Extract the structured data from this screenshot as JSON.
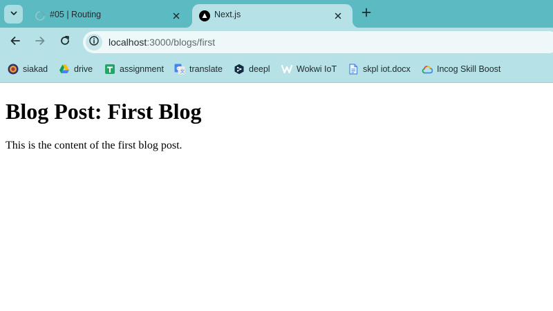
{
  "browser": {
    "tabs": [
      {
        "title": "#05 | Routing",
        "active": false,
        "favicon": "globe-loading-icon"
      },
      {
        "title": "Next.js",
        "active": true,
        "favicon": "nextjs-triangle-icon"
      }
    ],
    "address": {
      "host": "localhost",
      "rest": ":3000/blogs/first"
    },
    "bookmarks": [
      {
        "label": "siakad",
        "icon": "siakad-crest-icon"
      },
      {
        "label": "drive",
        "icon": "google-drive-icon"
      },
      {
        "label": "assignment",
        "icon": "google-sheets-icon"
      },
      {
        "label": "translate",
        "icon": "google-translate-icon"
      },
      {
        "label": "deepl",
        "icon": "deepl-icon"
      },
      {
        "label": "Wokwi IoT",
        "icon": "wokwi-icon"
      },
      {
        "label": "skpl iot.docx",
        "icon": "document-icon"
      },
      {
        "label": "Incog Skill Boost",
        "icon": "google-cloud-icon"
      }
    ],
    "colors": {
      "tab_strip": "#5bbac2",
      "toolbar": "#b6e1e6",
      "omnibox": "#eef8f9"
    }
  },
  "page": {
    "heading": "Blog Post: First Blog",
    "body": "This is the content of the first blog post."
  }
}
